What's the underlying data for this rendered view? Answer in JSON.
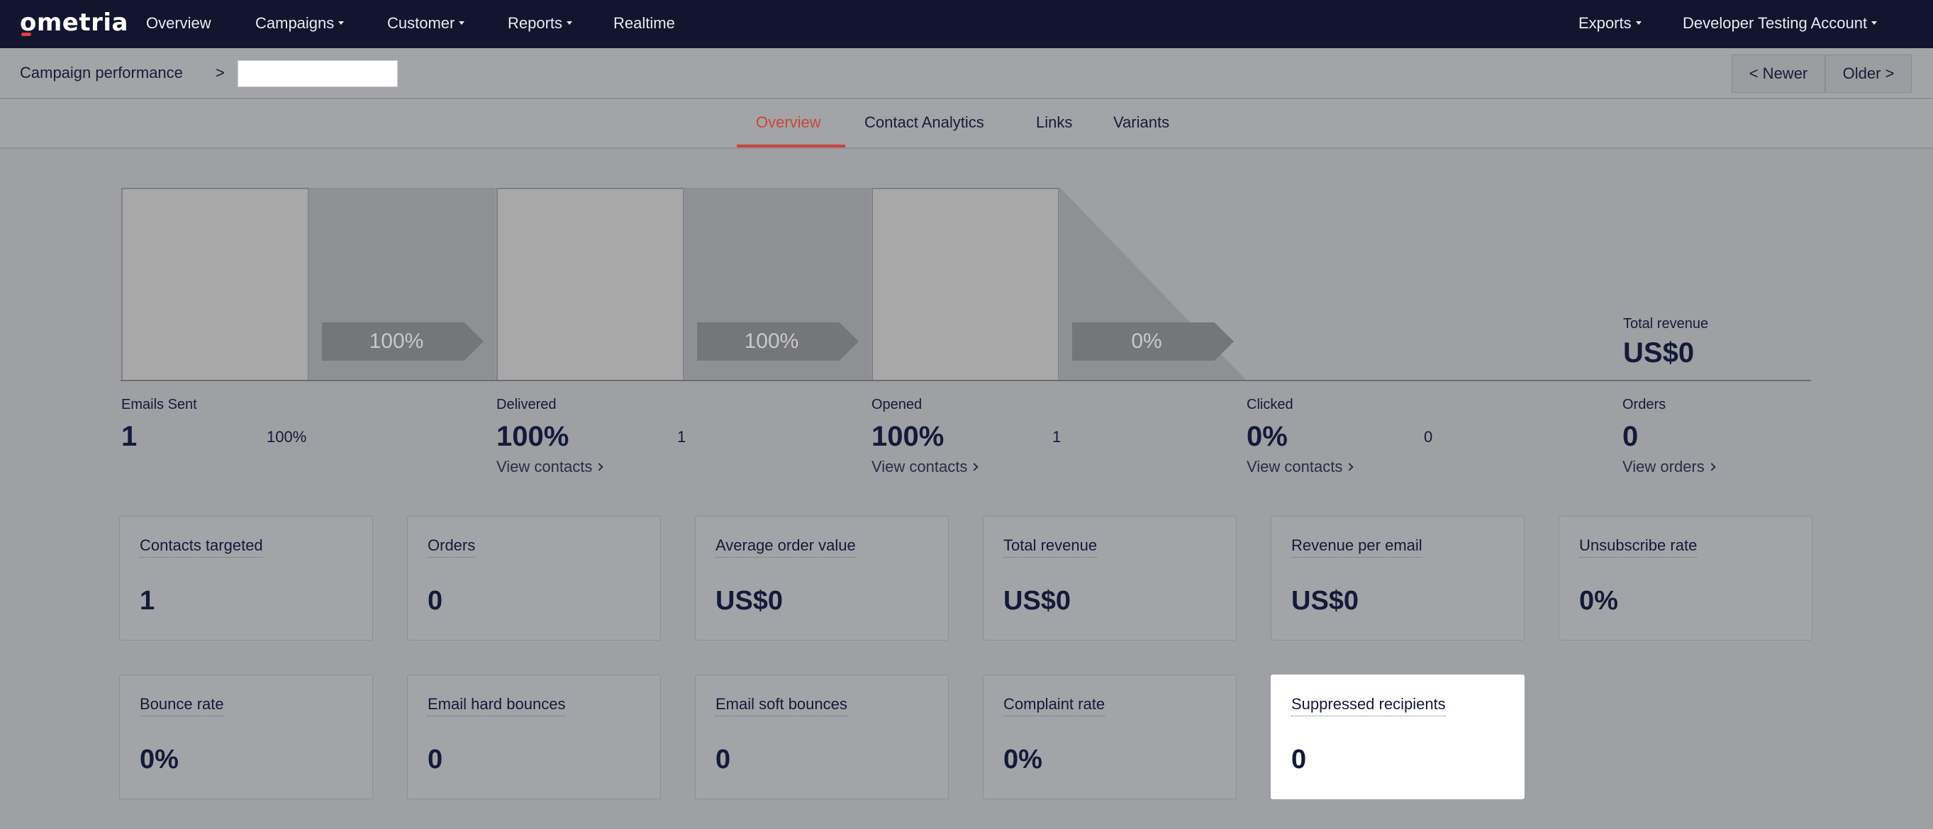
{
  "nav": {
    "logo": "ometria",
    "items": [
      "Overview",
      "Campaigns",
      "Customer",
      "Reports",
      "Realtime"
    ],
    "right": [
      "Exports",
      "Developer Testing Account"
    ]
  },
  "breadcrumb": {
    "title": "Campaign performance",
    "separator": ">"
  },
  "pager": {
    "newer": "< Newer",
    "older": "Older >"
  },
  "tabs": [
    "Overview",
    "Contact Analytics",
    "Links",
    "Variants"
  ],
  "active_tab": "Overview",
  "funnel": {
    "arrows": [
      "100%",
      "100%",
      "0%"
    ],
    "total_revenue_label": "Total revenue",
    "total_revenue_value": "US$0"
  },
  "stats": [
    {
      "label": "Emails Sent",
      "value": "1",
      "side": "100%"
    },
    {
      "label": "Delivered",
      "value": "100%",
      "side": "1",
      "link": "View contacts"
    },
    {
      "label": "Opened",
      "value": "100%",
      "side": "1",
      "link": "View contacts"
    },
    {
      "label": "Clicked",
      "value": "0%",
      "side": "0",
      "link": "View contacts"
    },
    {
      "label": "Orders",
      "value": "0",
      "link": "View orders"
    }
  ],
  "cards_row1": [
    {
      "label": "Contacts targeted",
      "value": "1"
    },
    {
      "label": "Orders",
      "value": "0"
    },
    {
      "label": "Average order value",
      "value": "US$0"
    },
    {
      "label": "Total revenue",
      "value": "US$0"
    },
    {
      "label": "Revenue per email",
      "value": "US$0"
    },
    {
      "label": "Unsubscribe rate",
      "value": "0%"
    }
  ],
  "cards_row2": [
    {
      "label": "Bounce rate",
      "value": "0%"
    },
    {
      "label": "Email hard bounces",
      "value": "0"
    },
    {
      "label": "Email soft bounces",
      "value": "0"
    },
    {
      "label": "Complaint rate",
      "value": "0%"
    },
    {
      "label": "Suppressed recipients",
      "value": "0"
    }
  ]
}
